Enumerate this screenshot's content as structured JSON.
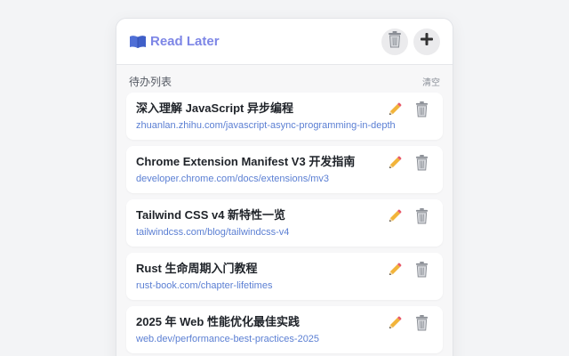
{
  "header": {
    "title": "Read Later",
    "title_icon": "book-icon",
    "buttons": [
      {
        "icon": "trash-icon"
      },
      {
        "icon": "plus-icon"
      }
    ]
  },
  "section": {
    "title": "待办列表",
    "clear_label": "清空"
  },
  "items": [
    {
      "title": "深入理解 JavaScript 异步编程",
      "url": "zhuanlan.zhihu.com/javascript-async-programming-in-depth"
    },
    {
      "title": "Chrome Extension Manifest V3 开发指南",
      "url": "developer.chrome.com/docs/extensions/mv3"
    },
    {
      "title": "Tailwind CSS v4 新特性一览",
      "url": "tailwindcss.com/blog/tailwindcss-v4"
    },
    {
      "title": "Rust 生命周期入门教程",
      "url": "rust-book.com/chapter-lifetimes"
    },
    {
      "title": "2025 年 Web 性能优化最佳实践",
      "url": "web.dev/performance-best-practices-2025"
    }
  ],
  "colors": {
    "accent": "#7d86e6",
    "url": "#5b7fd3"
  }
}
